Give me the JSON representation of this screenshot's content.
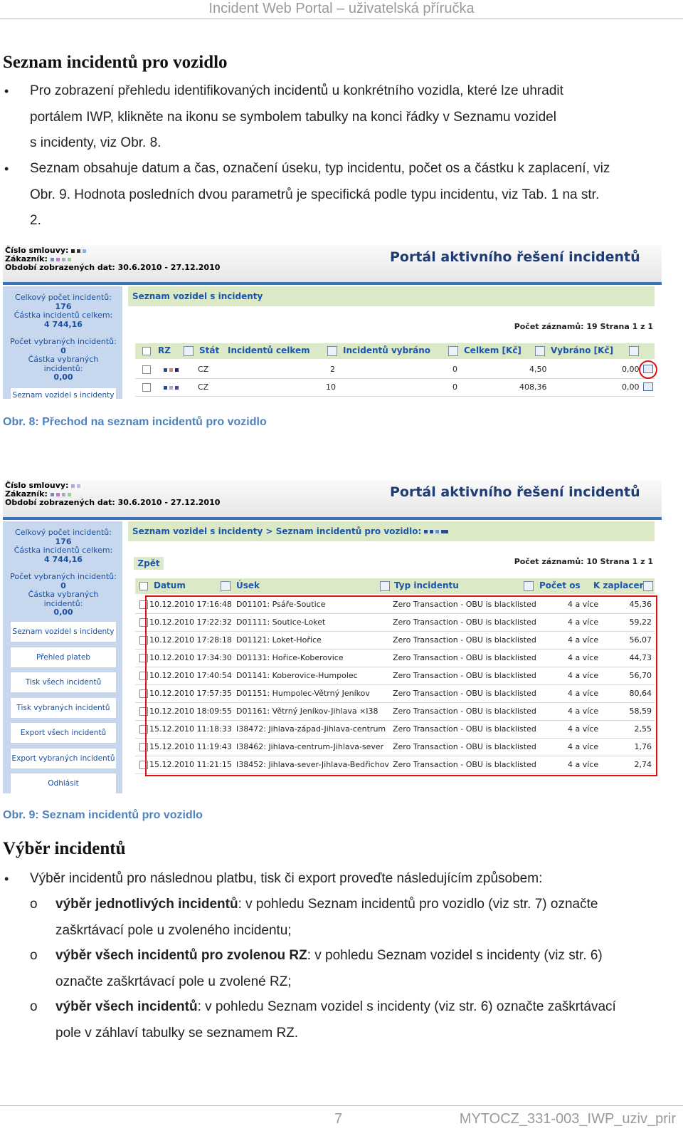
{
  "header": {
    "title": "Incident Web Portal – uživatelská příručka"
  },
  "section1": {
    "heading": "Seznam incidentů pro vozidlo",
    "bullets": [
      [
        "Pro zobrazení přehledu identifikovaných incidentů u konkrétního vozidla, které lze uhradit",
        "portálem IWP, klikněte na ikonu se symbolem tabulky na konci řádky v Seznamu vozidel",
        "s incidenty, viz Obr. 8."
      ],
      [
        "Seznam obsahuje datum a čas, označení úseku, typ incidentu, počet os a částku k zaplacení, viz",
        "Obr. 9. Hodnota posledních dvou parametrů je specifická podle typu incidentu, viz Tab. 1 na str.",
        "2."
      ]
    ]
  },
  "fig8": {
    "meta": [
      "Číslo smlouvy:",
      "Zákazník:",
      "Období zobrazených dat: 30.6.2010 - 27.12.2010"
    ],
    "portal_title": "Portál aktivního řešení incidentů",
    "side": {
      "l1": "Celkový počet incidentů:",
      "v1": "176",
      "l2": "Částka incidentů celkem:",
      "v2": "4 744,16",
      "l3": "Počet vybraných incidentů:",
      "v3": "0",
      "l4": "Částka vybraných incidentů:",
      "v4": "0,00",
      "btn": "Seznam vozidel s incidenty"
    },
    "crumb": "Seznam vozidel s incidenty",
    "count": "Počet záznamů: 19 Strana 1 z 1",
    "columns": [
      "RZ",
      "Stát",
      "Incidentů celkem",
      "Incidentů vybráno",
      "Celkem [Kč]",
      "Vybráno [Kč]"
    ],
    "rows": [
      {
        "stat": "CZ",
        "celkem": "2",
        "vybrano": "0",
        "kc": "4,50",
        "vkc": "0,00"
      },
      {
        "stat": "CZ",
        "celkem": "10",
        "vybrano": "0",
        "kc": "408,36",
        "vkc": "0,00"
      }
    ],
    "caption": "Obr. 8: Přechod na seznam incidentů pro vozidlo"
  },
  "fig9": {
    "crumb": "Seznam vozidel s incidenty > Seznam incidentů pro vozidlo:",
    "back": "Zpět",
    "count": "Počet záznamů: 10 Strana 1 z 1",
    "columns": [
      "Datum",
      "Úsek",
      "Typ incidentu",
      "Počet os",
      "K zaplacení"
    ],
    "side_buttons": [
      "Seznam vozidel s incidenty",
      "Přehled plateb",
      "Tisk všech incidentů",
      "Tisk vybraných incidentů",
      "Export všech incidentů",
      "Export vybraných incidentů",
      "Odhlásit"
    ],
    "rows": [
      {
        "datum": "10.12.2010 17:16:48",
        "usek": "D01101: Psáře-Soutice",
        "typ": "Zero Transaction - OBU is blacklisted",
        "os": "4 a více",
        "kc": "45,36"
      },
      {
        "datum": "10.12.2010 17:22:32",
        "usek": "D01111: Soutice-Loket",
        "typ": "Zero Transaction - OBU is blacklisted",
        "os": "4 a více",
        "kc": "59,22"
      },
      {
        "datum": "10.12.2010 17:28:18",
        "usek": "D01121: Loket-Hořice",
        "typ": "Zero Transaction - OBU is blacklisted",
        "os": "4 a více",
        "kc": "56,07"
      },
      {
        "datum": "10.12.2010 17:34:30",
        "usek": "D01131: Hořice-Koberovice",
        "typ": "Zero Transaction - OBU is blacklisted",
        "os": "4 a více",
        "kc": "44,73"
      },
      {
        "datum": "10.12.2010 17:40:54",
        "usek": "D01141: Koberovice-Humpolec",
        "typ": "Zero Transaction - OBU is blacklisted",
        "os": "4 a více",
        "kc": "56,70"
      },
      {
        "datum": "10.12.2010 17:57:35",
        "usek": "D01151: Humpolec-Větrný Jeníkov",
        "typ": "Zero Transaction - OBU is blacklisted",
        "os": "4 a více",
        "kc": "80,64"
      },
      {
        "datum": "10.12.2010 18:09:55",
        "usek": "D01161: Větrný Jeníkov-Jihlava ×I38",
        "typ": "Zero Transaction - OBU is blacklisted",
        "os": "4 a více",
        "kc": "58,59"
      },
      {
        "datum": "15.12.2010 11:18:33",
        "usek": "I38472: Jihlava-západ-Jihlava-centrum",
        "typ": "Zero Transaction - OBU is blacklisted",
        "os": "4 a více",
        "kc": "2,55"
      },
      {
        "datum": "15.12.2010 11:19:43",
        "usek": "I38462: Jihlava-centrum-Jihlava-sever",
        "typ": "Zero Transaction - OBU is blacklisted",
        "os": "4 a více",
        "kc": "1,76"
      },
      {
        "datum": "15.12.2010 11:21:15",
        "usek": "I38452: Jihlava-sever-Jihlava-Bedřichov",
        "typ": "Zero Transaction - OBU is blacklisted",
        "os": "4 a více",
        "kc": "2,74"
      }
    ],
    "caption": "Obr. 9: Seznam incidentů pro vozidlo"
  },
  "section2": {
    "heading": "Výběr incidentů",
    "intro": "Výběr incidentů pro následnou platbu, tisk či export proveďte následujícím způsobem:",
    "items": [
      {
        "bold": "výběr jednotlivých incidentů",
        "rest1": ": v pohledu Seznam incidentů pro vozidlo (viz str. 7) označte",
        "rest2": "zaškrtávací pole u zvoleného incidentu;"
      },
      {
        "bold": "výběr všech incidentů pro zvolenou RZ",
        "rest1": ": v pohledu Seznam vozidel s incidenty (viz str. 6)",
        "rest2": "označte zaškrtávací pole u zvolené RZ;"
      },
      {
        "bold": "výběr všech incidentů",
        "rest1": ": v pohledu Seznam vozidel s incidenty (viz str. 6) označte zaškrtávací",
        "rest2": "pole v záhlaví tabulky se seznamem RZ."
      }
    ]
  },
  "footer": {
    "page": "7",
    "docid": "MYTOCZ_331-003_IWP_uziv_prir"
  }
}
